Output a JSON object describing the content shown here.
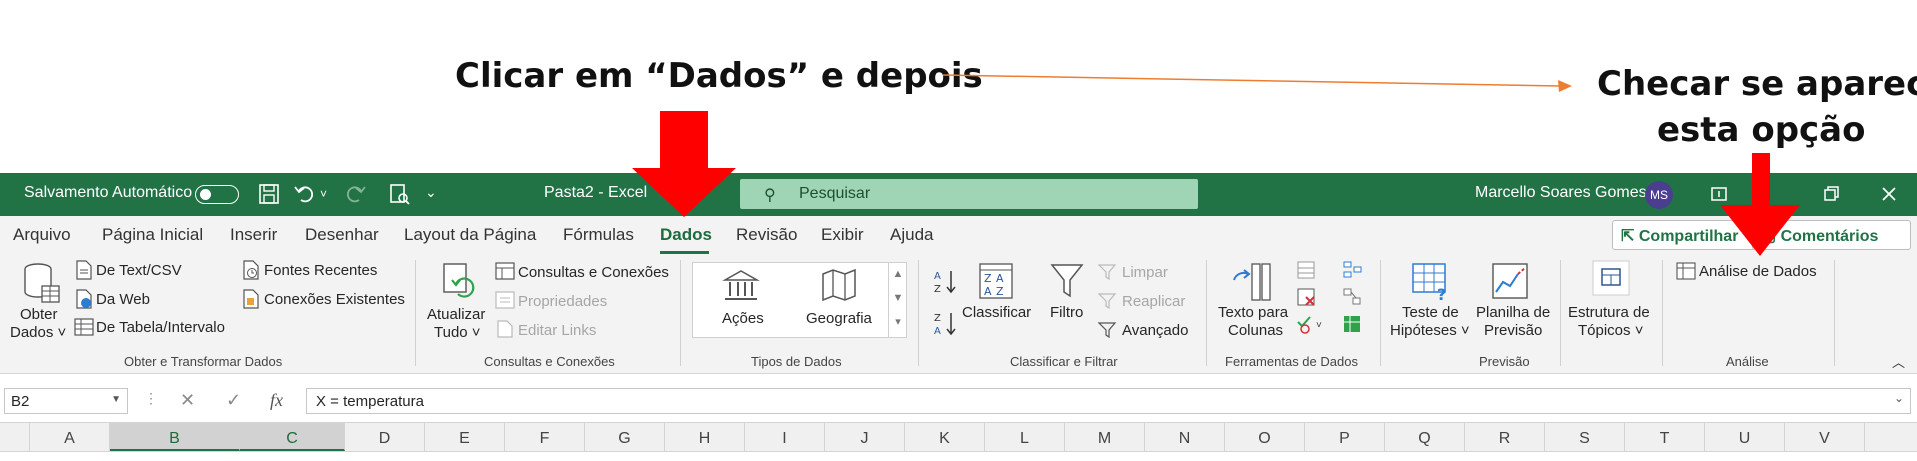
{
  "annotations": {
    "left_text": "Clicar em “Dados” e depois",
    "right_line1": "Checar se aparece",
    "right_line2": "esta opção"
  },
  "titlebar": {
    "autosave_label": "Salvamento Automático",
    "doc_title": "Pasta2  -  Excel",
    "search_placeholder": "Pesquisar",
    "user_name": "Marcello Soares Gomes",
    "avatar_initials": "MS",
    "bg_color": "#217346"
  },
  "tabs": [
    {
      "label": "Arquivo"
    },
    {
      "label": "Página Inicial"
    },
    {
      "label": "Inserir"
    },
    {
      "label": "Desenhar"
    },
    {
      "label": "Layout da Página"
    },
    {
      "label": "Fórmulas"
    },
    {
      "label": "Dados",
      "active": true
    },
    {
      "label": "Revisão"
    },
    {
      "label": "Exibir"
    },
    {
      "label": "Ajuda"
    }
  ],
  "share": {
    "share_label": "Compartilhar",
    "comments_label": "Comentários"
  },
  "ribbon": {
    "obter": {
      "obter_dados_l1": "Obter",
      "obter_dados_l2": "Dados ˅",
      "de_texto": "De Text/CSV",
      "da_web": "Da Web",
      "de_tabela": "De Tabela/Intervalo",
      "fontes_recentes": "Fontes Recentes",
      "conexoes_existentes": "Conexões Existentes",
      "group_label": "Obter e Transformar Dados"
    },
    "consultas": {
      "atualizar_l1": "Atualizar",
      "atualizar_l2": "Tudo ˅",
      "consultas_conexoes": "Consultas e Conexões",
      "propriedades": "Propriedades",
      "editar_links": "Editar Links",
      "group_label": "Consultas e Conexões"
    },
    "tipos": {
      "acoes": "Ações",
      "geografia": "Geografia",
      "group_label": "Tipos de Dados"
    },
    "classificar": {
      "classificar": "Classificar",
      "filtro": "Filtro",
      "limpar": "Limpar",
      "reaplicar": "Reaplicar",
      "avancado": "Avançado",
      "group_label": "Classificar e Filtrar"
    },
    "ferramentas": {
      "texto_l1": "Texto para",
      "texto_l2": "Colunas",
      "group_label": "Ferramentas de Dados"
    },
    "previsao": {
      "teste_l1": "Teste de",
      "teste_l2": "Hipóteses ˅",
      "planilha_l1": "Planilha de",
      "planilha_l2": "Previsão",
      "group_label": "Previsão"
    },
    "estrutura": {
      "l1": "Estrutura de",
      "l2": "Tópicos ˅"
    },
    "analise": {
      "analise_dados": "Análise de Dados",
      "group_label": "Análise"
    }
  },
  "formula_bar": {
    "name_box": "B2",
    "formula": "X = temperatura",
    "fx": "fx"
  },
  "columns": [
    "A",
    "B",
    "C",
    "D",
    "E",
    "F",
    "G",
    "H",
    "I",
    "J",
    "K",
    "L",
    "M",
    "N",
    "O",
    "P",
    "Q",
    "R",
    "S",
    "T",
    "U",
    "V"
  ],
  "selected_columns": [
    "B",
    "C"
  ]
}
